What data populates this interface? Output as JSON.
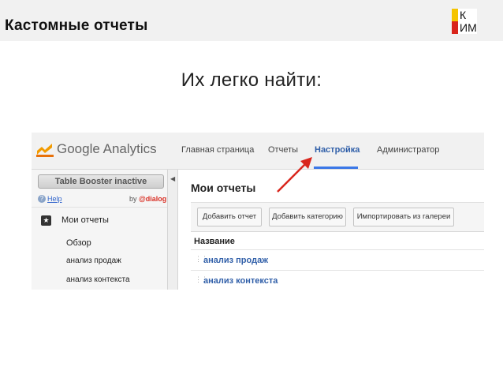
{
  "slide": {
    "title": "Кастомные отчеты",
    "subtitle": "Их легко найти:",
    "logo_line1": "К",
    "logo_line2": "ИМ"
  },
  "ga": {
    "logo_text": "Google Analytics",
    "nav": [
      {
        "label": "Главная страница",
        "active": false
      },
      {
        "label": "Отчеты",
        "active": false
      },
      {
        "label": "Настройка",
        "active": true
      },
      {
        "label": "Администратор",
        "active": false
      }
    ],
    "sidebar": {
      "table_booster_label": "Table Booster inactive",
      "help_label": "Help",
      "by_label": "by",
      "dialog_label": "@dialog",
      "my_reports_label": "Мои отчеты",
      "items": [
        "Обзор",
        "анализ продаж",
        "анализ контекста"
      ]
    },
    "main": {
      "title": "Мои отчеты",
      "buttons": [
        "Добавить отчет",
        "Добавить категорию",
        "Импортировать из галереи"
      ],
      "column_header": "Название",
      "rows": [
        "анализ продаж",
        "анализ контекста"
      ]
    }
  },
  "colors": {
    "accent_blue": "#2f5ea8",
    "tab_underline": "#3b78e7",
    "arrow_red": "#d9251c",
    "logo_yellow": "#f5c400",
    "logo_red": "#d9251c"
  }
}
